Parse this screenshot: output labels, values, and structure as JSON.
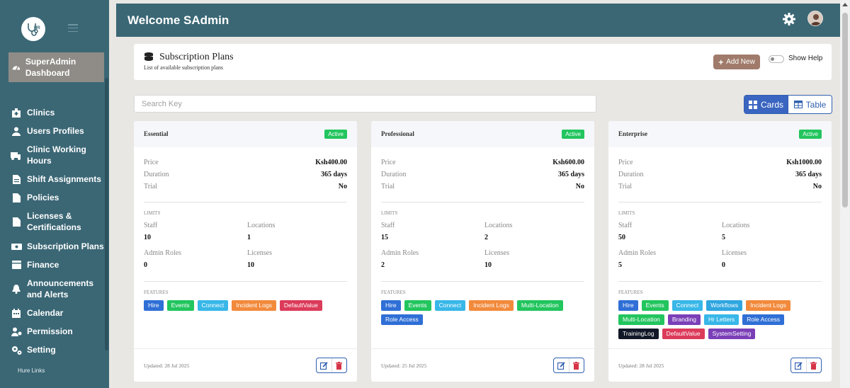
{
  "sidebar": {
    "dashboard": "SuperAdmin Dashboard",
    "items": [
      {
        "label": "Clinics",
        "icon": "clinic-icon"
      },
      {
        "label": "Users Profiles",
        "icon": "user-icon"
      },
      {
        "label": "Clinic Working Hours",
        "icon": "truck-clock-icon"
      },
      {
        "label": "Shift Assignments",
        "icon": "document-icon"
      },
      {
        "label": "Policies",
        "icon": "file-icon"
      },
      {
        "label": "Licenses & Certifications",
        "icon": "file-icon"
      },
      {
        "label": "Subscription Plans",
        "icon": "money-icon"
      },
      {
        "label": "Finance",
        "icon": "wallet-icon"
      },
      {
        "label": "Announcements and Alerts",
        "icon": "bell-icon"
      },
      {
        "label": "Calendar",
        "icon": "calendar-icon"
      },
      {
        "label": "Permission",
        "icon": "user-gear-icon"
      },
      {
        "label": "Setting",
        "icon": "gears-icon"
      }
    ],
    "footer_link": "Hure Links"
  },
  "header": {
    "title": "Welcome SAdmin"
  },
  "plans_header": {
    "title": "Subscription Plans",
    "subtitle": "List of available subscription plans",
    "add_new": "Add New",
    "show_help": "Show Help"
  },
  "search": {
    "placeholder": "Search Key"
  },
  "view_toggle": {
    "cards": "Cards",
    "table": "Table",
    "selected": "Cards"
  },
  "labels": {
    "price": "Price",
    "duration": "Duration",
    "trial": "Trial",
    "limits": "LIMITS",
    "staff": "Staff",
    "locations": "Locations",
    "admin_roles": "Admin Roles",
    "licenses": "Licenses",
    "features": "FEATURES"
  },
  "plans": [
    {
      "name": "Essential",
      "status": "Active",
      "price": "Ksh400.00",
      "duration": "365 days",
      "trial": "No",
      "staff": "10",
      "locations": "1",
      "admin_roles": "0",
      "licenses": "10",
      "features": [
        {
          "label": "Hire",
          "color": "#2f6fd6"
        },
        {
          "label": "Events",
          "color": "#22c55e"
        },
        {
          "label": "Connect",
          "color": "#38b7e8"
        },
        {
          "label": "Incident Logs",
          "color": "#f28a3c"
        },
        {
          "label": "DefaultValue",
          "color": "#dc3b5a"
        }
      ],
      "updated": "Updated: 28 Jul 2025"
    },
    {
      "name": "Professional",
      "status": "Active",
      "price": "Ksh600.00",
      "duration": "365 days",
      "trial": "No",
      "staff": "15",
      "locations": "2",
      "admin_roles": "2",
      "licenses": "10",
      "features": [
        {
          "label": "Hire",
          "color": "#2f6fd6"
        },
        {
          "label": "Events",
          "color": "#22c55e"
        },
        {
          "label": "Connect",
          "color": "#38b7e8"
        },
        {
          "label": "Incident Logs",
          "color": "#f28a3c"
        },
        {
          "label": "Multi-Location",
          "color": "#22c55e"
        },
        {
          "label": "Role Access",
          "color": "#2f6fd6"
        }
      ],
      "updated": "Updated: 25 Jul 2025"
    },
    {
      "name": "Enterprise",
      "status": "Active",
      "price": "Ksh1000.00",
      "duration": "365 days",
      "trial": "No",
      "staff": "50",
      "locations": "5",
      "admin_roles": "5",
      "licenses": "0",
      "features": [
        {
          "label": "Hire",
          "color": "#2f6fd6"
        },
        {
          "label": "Events",
          "color": "#22c55e"
        },
        {
          "label": "Connect",
          "color": "#38b7e8"
        },
        {
          "label": "Workflows",
          "color": "#2fa6e0"
        },
        {
          "label": "Incident Logs",
          "color": "#f28a3c"
        },
        {
          "label": "Multi-Location",
          "color": "#22c55e"
        },
        {
          "label": "Branding",
          "color": "#7b3fb8"
        },
        {
          "label": "Hr Letters",
          "color": "#38b7e8"
        },
        {
          "label": "Role Access",
          "color": "#2f6fd6"
        },
        {
          "label": "TrainingLog",
          "color": "#111827"
        },
        {
          "label": "DefaultValue",
          "color": "#dc3b5a"
        },
        {
          "label": "SystemSetting",
          "color": "#7b3fb8"
        }
      ],
      "updated": "Updated: 28 Jul 2025"
    }
  ],
  "colors": {
    "sidebar": "#3b6775",
    "header": "#3b6775",
    "active_badge": "#22c55e",
    "add_new": "#a07b6b",
    "primary": "#3a65c0"
  }
}
